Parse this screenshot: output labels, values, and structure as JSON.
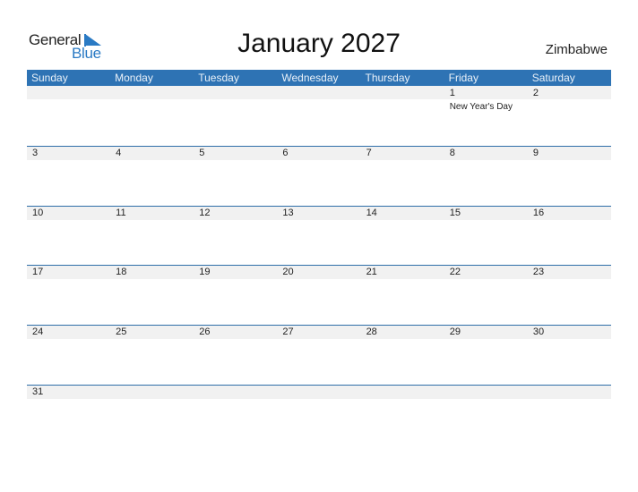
{
  "logo": {
    "general": "General",
    "blue": "Blue"
  },
  "title": "January 2027",
  "country": "Zimbabwe",
  "colors": {
    "header_bg": "#2e73b4",
    "accent": "#2a7ac4",
    "band": "#f1f1f1"
  },
  "weekdays": [
    "Sunday",
    "Monday",
    "Tuesday",
    "Wednesday",
    "Thursday",
    "Friday",
    "Saturday"
  ],
  "weeks": [
    [
      {
        "day": ""
      },
      {
        "day": ""
      },
      {
        "day": ""
      },
      {
        "day": ""
      },
      {
        "day": ""
      },
      {
        "day": "1",
        "event": "New Year's Day"
      },
      {
        "day": "2"
      }
    ],
    [
      {
        "day": "3"
      },
      {
        "day": "4"
      },
      {
        "day": "5"
      },
      {
        "day": "6"
      },
      {
        "day": "7"
      },
      {
        "day": "8"
      },
      {
        "day": "9"
      }
    ],
    [
      {
        "day": "10"
      },
      {
        "day": "11"
      },
      {
        "day": "12"
      },
      {
        "day": "13"
      },
      {
        "day": "14"
      },
      {
        "day": "15"
      },
      {
        "day": "16"
      }
    ],
    [
      {
        "day": "17"
      },
      {
        "day": "18"
      },
      {
        "day": "19"
      },
      {
        "day": "20"
      },
      {
        "day": "21"
      },
      {
        "day": "22"
      },
      {
        "day": "23"
      }
    ],
    [
      {
        "day": "24"
      },
      {
        "day": "25"
      },
      {
        "day": "26"
      },
      {
        "day": "27"
      },
      {
        "day": "28"
      },
      {
        "day": "29"
      },
      {
        "day": "30"
      }
    ],
    [
      {
        "day": "31"
      },
      {
        "day": ""
      },
      {
        "day": ""
      },
      {
        "day": ""
      },
      {
        "day": ""
      },
      {
        "day": ""
      },
      {
        "day": ""
      }
    ]
  ]
}
